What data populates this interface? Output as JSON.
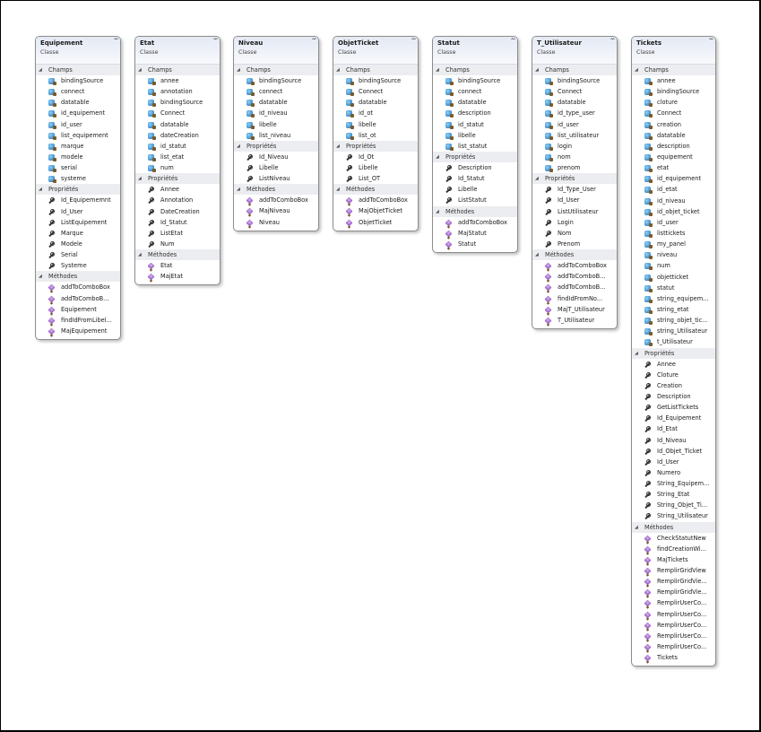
{
  "classes": [
    {
      "name": "Equipement",
      "stereotype": "Classe",
      "sections": [
        {
          "title": "Champs",
          "kind": "field",
          "items": [
            "bindingSource",
            "connect",
            "datatable",
            "id_equipement",
            "id_user",
            "list_equipement",
            "marque",
            "modele",
            "serial",
            "systeme"
          ]
        },
        {
          "title": "Propriétés",
          "kind": "prop",
          "items": [
            "Id_Equipememnt",
            "Id_User",
            "ListEquipement",
            "Marque",
            "Modele",
            "Serial",
            "Systeme"
          ]
        },
        {
          "title": "Méthodes",
          "kind": "meth",
          "items": [
            "addToComboBox",
            "addToComboB...",
            "Equipement",
            "findIdFromLibel...",
            "MajEquipement"
          ]
        }
      ]
    },
    {
      "name": "Etat",
      "stereotype": "Classe",
      "sections": [
        {
          "title": "Champs",
          "kind": "field",
          "items": [
            "annee",
            "annotation",
            "bindingSource",
            "Connect",
            "datatable",
            "dateCreation",
            "id_statut",
            "list_etat",
            "num"
          ]
        },
        {
          "title": "Propriétés",
          "kind": "prop",
          "items": [
            "Annee",
            "Annotation",
            "DateCreation",
            "Id_Statut",
            "ListEtat",
            "Num"
          ]
        },
        {
          "title": "Méthodes",
          "kind": "meth",
          "items": [
            "Etat",
            "MajEtat"
          ]
        }
      ]
    },
    {
      "name": "Niveau",
      "stereotype": "Classe",
      "sections": [
        {
          "title": "Champs",
          "kind": "field",
          "items": [
            "bindingSource",
            "connect",
            "datatable",
            "id_niveau",
            "libelle",
            "list_niveau"
          ]
        },
        {
          "title": "Propriétés",
          "kind": "prop",
          "items": [
            "Id_Niveau",
            "Libelle",
            "ListNiveau"
          ]
        },
        {
          "title": "Méthodes",
          "kind": "meth",
          "items": [
            "addToComboBox",
            "MajNiveau",
            "Niveau"
          ]
        }
      ]
    },
    {
      "name": "ObjetTicket",
      "stereotype": "Classe",
      "sections": [
        {
          "title": "Champs",
          "kind": "field",
          "items": [
            "bindingSource",
            "Connect",
            "datatable",
            "id_ot",
            "libelle",
            "list_ot"
          ]
        },
        {
          "title": "Propriétés",
          "kind": "prop",
          "items": [
            "Id_Ot",
            "Libelle",
            "List_OT"
          ]
        },
        {
          "title": "Méthodes",
          "kind": "meth",
          "items": [
            "addToComboBox",
            "MajObjetTicket",
            "ObjetTicket"
          ]
        }
      ]
    },
    {
      "name": "Statut",
      "stereotype": "Classe",
      "sections": [
        {
          "title": "Champs",
          "kind": "field",
          "items": [
            "bindingSource",
            "connect",
            "datatable",
            "description",
            "id_statut",
            "libelle",
            "list_statut"
          ]
        },
        {
          "title": "Propriétés",
          "kind": "prop",
          "items": [
            "Description",
            "Id_Statut",
            "Libelle",
            "ListStatut"
          ]
        },
        {
          "title": "Méthodes",
          "kind": "meth",
          "items": [
            "addToComboBox",
            "MajStatut",
            "Statut"
          ]
        }
      ]
    },
    {
      "name": "T_Utilisateur",
      "stereotype": "Classe",
      "sections": [
        {
          "title": "Champs",
          "kind": "field",
          "items": [
            "bindingSource",
            "Connect",
            "datatable",
            "id_type_user",
            "id_user",
            "list_utilisateur",
            "login",
            "nom",
            "prenom"
          ]
        },
        {
          "title": "Propriétés",
          "kind": "prop",
          "items": [
            "Id_Type_User",
            "Id_User",
            "ListUtilisateur",
            "Login",
            "Nom",
            "Prenom"
          ]
        },
        {
          "title": "Méthodes",
          "kind": "meth",
          "items": [
            "addToComboBox",
            "addToComboB...",
            "addToComboB...",
            "findIdFromNo...",
            "MajT_Utilisateur",
            "T_Utilisateur"
          ]
        }
      ]
    },
    {
      "name": "Tickets",
      "stereotype": "Classe",
      "sections": [
        {
          "title": "Champs",
          "kind": "field",
          "items": [
            "annee",
            "bindingSource",
            "cloture",
            "Connect",
            "creation",
            "datatable",
            "description",
            "equipement",
            "etat",
            "id_equipement",
            "id_etat",
            "id_niveau",
            "id_objet_ticket",
            "id_user",
            "listtickets",
            "my_panel",
            "niveau",
            "num",
            "objetticket",
            "statut",
            "string_equipem...",
            "string_etat",
            "string_objet_tic...",
            "string_Utilisateur",
            "t_Utilisateur"
          ]
        },
        {
          "title": "Propriétés",
          "kind": "prop",
          "items": [
            "Annee",
            "Cloture",
            "Creation",
            "Description",
            "GetListTickets",
            "Id_Equipement",
            "Id_Etat",
            "Id_Niveau",
            "Id_Objet_Ticket",
            "Id_User",
            "Numero",
            "String_Equipem...",
            "String_Etat",
            "String_Objet_Ti...",
            "String_Utilisateur"
          ]
        },
        {
          "title": "Méthodes",
          "kind": "meth",
          "items": [
            "CheckStatutNew",
            "findCreationWi...",
            "MajTickets",
            "RemplirGridView",
            "RemplirGridVie...",
            "RemplirGridVie...",
            "RemplirUserCo...",
            "RemplirUserCo...",
            "RemplirUserCo...",
            "RemplirUserCo...",
            "RemplirUserCo...",
            "Tickets"
          ]
        }
      ]
    }
  ]
}
